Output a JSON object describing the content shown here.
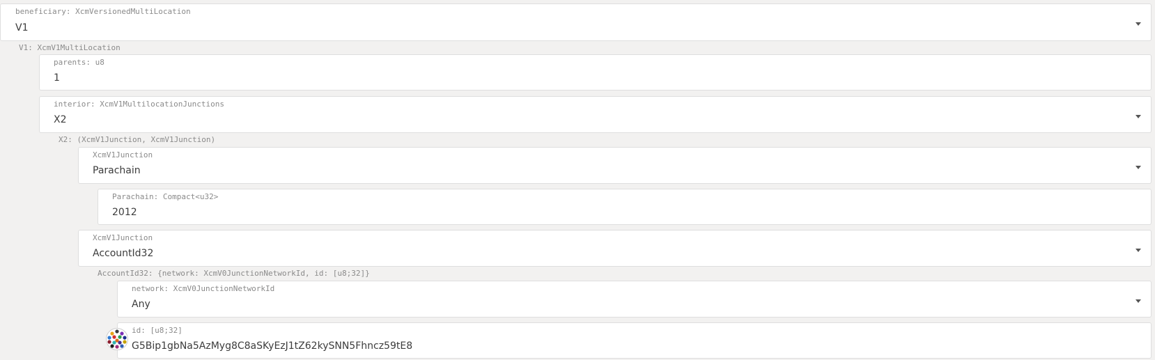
{
  "beneficiary": {
    "label": "beneficiary: XcmVersionedMultiLocation",
    "value": "V1"
  },
  "v1": {
    "label": "V1: XcmV1MultiLocation",
    "parents": {
      "label": "parents: u8",
      "value": "1"
    },
    "interior": {
      "label": "interior: XcmV1MultilocationJunctions",
      "value": "X2"
    }
  },
  "x2": {
    "label": "X2: (XcmV1Junction, XcmV1Junction)",
    "junction1": {
      "label": "XcmV1Junction",
      "value": "Parachain"
    },
    "parachain": {
      "label": "Parachain: Compact<u32>",
      "value": "2012"
    },
    "junction2": {
      "label": "XcmV1Junction",
      "value": "AccountId32"
    }
  },
  "account": {
    "label": "AccountId32: {network: XcmV0JunctionNetworkId, id: [u8;32]}",
    "network": {
      "label": "network: XcmV0JunctionNetworkId",
      "value": "Any"
    },
    "id": {
      "label": "id: [u8;32]",
      "value": "G5Bip1gbNa5AzMyg8C8aSKyEzJ1tZ62kySNN5Fhncz59tE8"
    }
  },
  "icons": {
    "dropdown": "chevron-down-icon",
    "identicon": "identicon-avatar"
  }
}
